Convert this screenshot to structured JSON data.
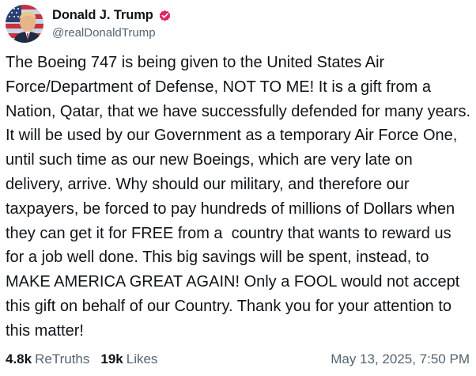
{
  "author": {
    "display_name": "Donald J. Trump",
    "handle": "@realDonaldTrump",
    "verified_icon": "verified-badge-icon",
    "verified_color": "#e0245e"
  },
  "post": {
    "text": "The Boeing 747 is being given to the United States Air Force/Department of Defense, NOT TO ME! It is a gift from a Nation, Qatar, that we have successfully defended for many years. It will be used by our Government as a temporary Air Force One, until such time as our new Boeings, which are very late on delivery, arrive. Why should our military, and therefore our taxpayers, be forced to pay hundreds of millions of Dollars when they can get it for FREE from a  country that wants to reward us for a job well done. This big savings will be spent, instead, to MAKE AMERICA GREAT AGAIN! Only a FOOL would not accept this gift on behalf of our Country. Thank you for your attention to this matter!"
  },
  "stats": {
    "retruths_count": "4.8k",
    "retruths_label": "ReTruths",
    "likes_count": "19k",
    "likes_label": "Likes"
  },
  "timestamp": "May 13, 2025, 7:50 PM"
}
